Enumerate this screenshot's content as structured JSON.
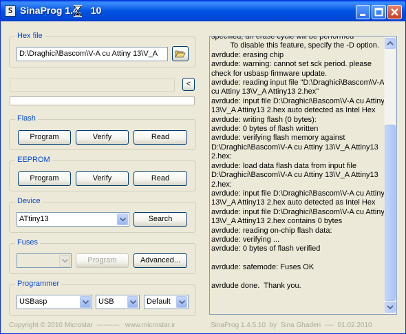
{
  "window": {
    "title_part1": "SinaProg 1.4.",
    "title_part2": "10",
    "icon_glyph": "S"
  },
  "titlebar_buttons": {
    "minimize": "_",
    "maximize": "□",
    "close": "✕"
  },
  "hex_file": {
    "label": "Hex file",
    "path": "D:\\Draghici\\Bascom\\V-A cu Attiny 13\\V_A"
  },
  "collapse_button": "<",
  "progress": {
    "value": 0
  },
  "flash": {
    "label": "Flash",
    "program": "Program",
    "verify": "Verify",
    "read": "Read"
  },
  "eeprom": {
    "label": "EEPROM",
    "program": "Program",
    "verify": "Verify",
    "read": "Read"
  },
  "device": {
    "label": "Device",
    "selected": "ATtiny13",
    "search": "Search"
  },
  "fuses": {
    "label": "Fuses",
    "selected": "",
    "program": "Program",
    "advanced": "Advanced..."
  },
  "programmer": {
    "label": "Programmer",
    "programmer": "USBasp",
    "port": "USB",
    "speed": "Default"
  },
  "log": {
    "text": "specified, an erase cycle will be performed\n         To disable this feature, specify the -D option.\navrdude: erasing chip\navrdude: warning: cannot set sck period. please check for usbasp firmware update.\navrdude: reading input file \"D:\\Draghici\\Bascom\\V-A cu Attiny 13\\V_A Attiny13 2.hex\"\navrdude: input file D:\\Draghici\\Bascom\\V-A cu Attiny 13\\V_A Attiny13 2.hex auto detected as Intel Hex\navrdude: writing flash (0 bytes):\navrdude: 0 bytes of flash written\navrdude: verifying flash memory against D:\\Draghici\\Bascom\\V-A cu Attiny 13\\V_A Attiny13 2.hex:\navrdude: load data flash data from input file D:\\Draghici\\Bascom\\V-A cu Attiny 13\\V_A Attiny13 2.hex:\navrdude: input file D:\\Draghici\\Bascom\\V-A cu Attiny 13\\V_A Attiny13 2.hex auto detected as Intel Hex\navrdude: input file D:\\Draghici\\Bascom\\V-A cu Attiny 13\\V_A Attiny13 2.hex contains 0 bytes\navrdude: reading on-chip flash data:\navrdude: verifying ...\navrdude: 0 bytes of flash verified\n\navrdude: safemode: Fuses OK\n\navrdude done.  Thank you."
  },
  "footer": {
    "copyright": "Copyright © 2010 Microstar  ----------   www.microstar.ir",
    "version": "SinaProg 1.4.5.10  by  Sina Ghaderi  ----  01.02.2010"
  },
  "icons": {
    "app": "sinaprog-app-icon",
    "busy": "hourglass-icon",
    "open": "open-folder-icon",
    "dropdown": "chevron-down-icon"
  },
  "colors": {
    "titlebar": "#0054e3",
    "group_label": "#0046d5",
    "window_bg": "#ece9d8",
    "close": "#c4401f"
  }
}
